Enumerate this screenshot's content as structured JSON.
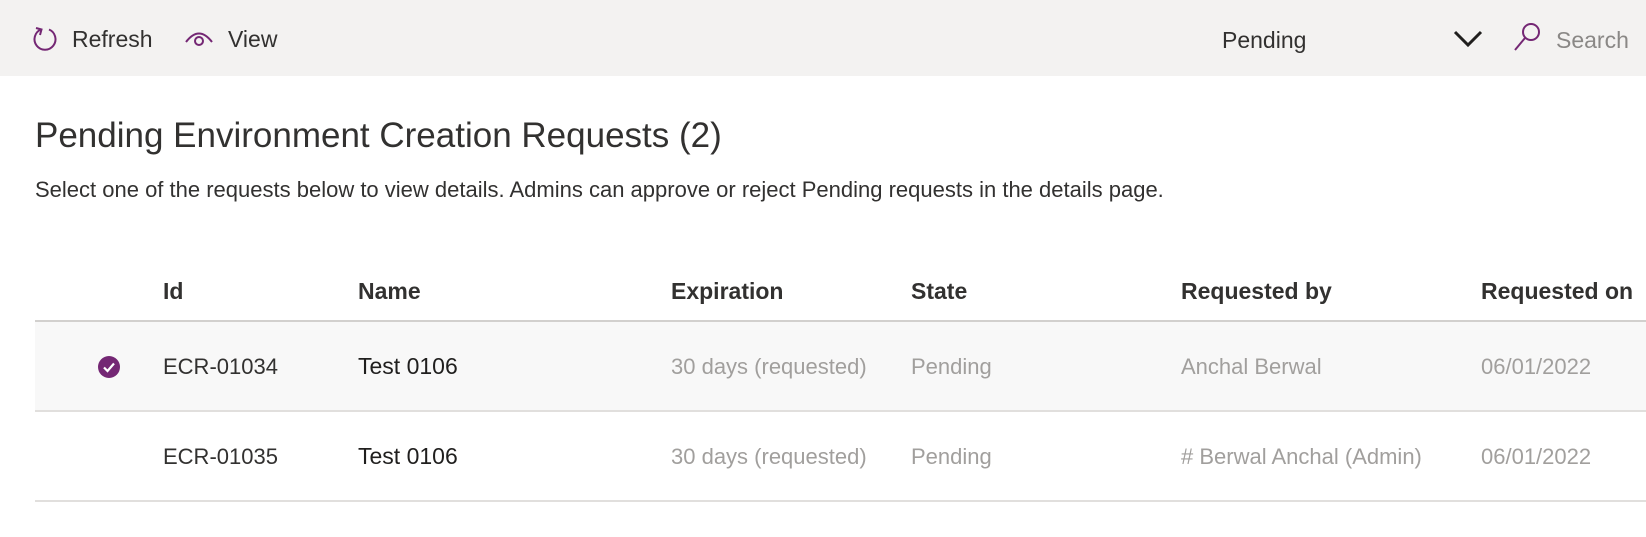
{
  "toolbar": {
    "refresh_label": "Refresh",
    "view_label": "View",
    "filter_value": "Pending",
    "search_placeholder": "Search"
  },
  "header": {
    "title": "Pending Environment Creation Requests (2)",
    "subtitle": "Select one of the requests below to view details. Admins can approve or reject Pending requests in the details page."
  },
  "table": {
    "columns": [
      "Id",
      "Name",
      "Expiration",
      "State",
      "Requested by",
      "Requested on"
    ],
    "rows": [
      {
        "selected": true,
        "id": "ECR-01034",
        "name": "Test 0106",
        "expiration": "30 days (requested)",
        "state": "Pending",
        "requested_by": "Anchal Berwal",
        "requested_on": "06/01/2022"
      },
      {
        "selected": false,
        "id": "ECR-01035",
        "name": "Test 0106",
        "expiration": "30 days (requested)",
        "state": "Pending",
        "requested_by": "# Berwal Anchal (Admin)",
        "requested_on": "06/01/2022"
      }
    ]
  },
  "icons": {
    "refresh": "refresh-icon",
    "view": "eye-icon",
    "dropdown": "chevron-down-icon",
    "search": "search-icon",
    "selected_row": "checkmark-circle-icon"
  },
  "colors": {
    "accent": "#742774",
    "toolbar_bg": "#f3f2f1",
    "selected_row_bg": "#f8f8f8"
  }
}
